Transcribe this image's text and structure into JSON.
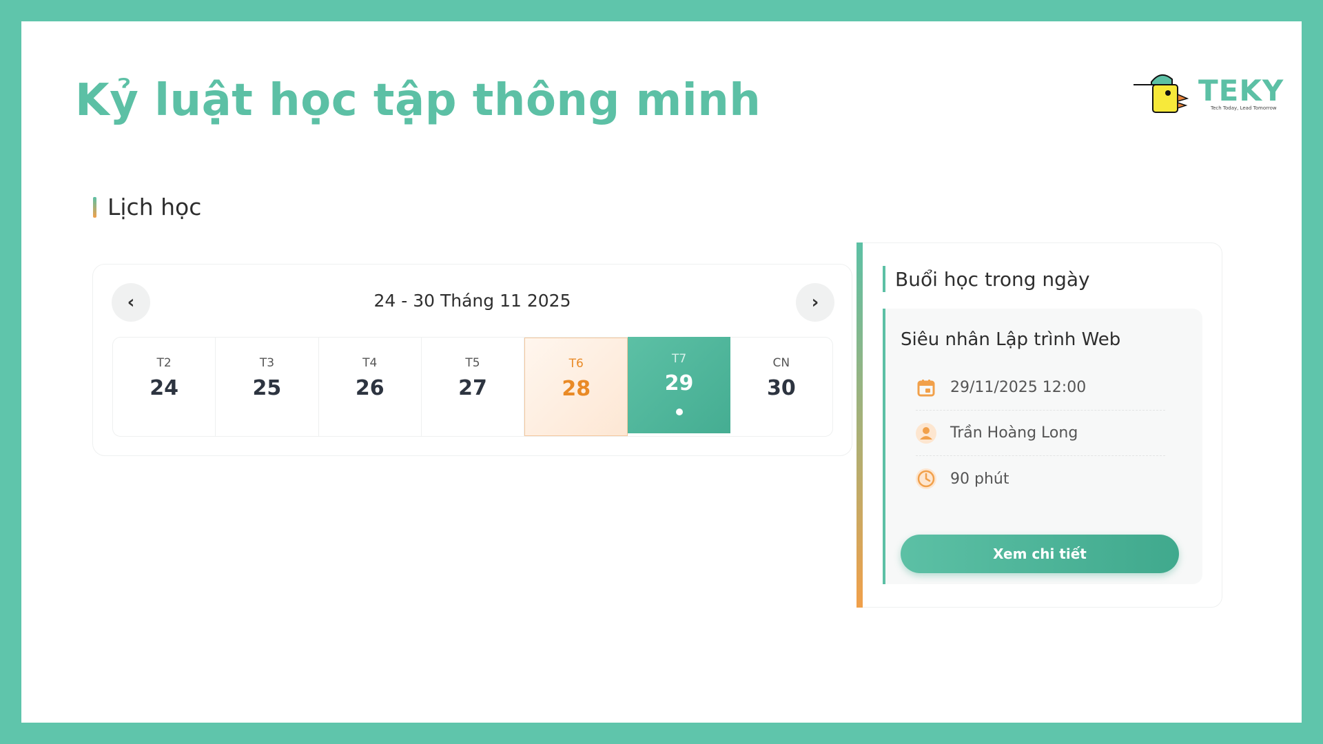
{
  "page": {
    "title": "Kỷ luật học tập thông minh"
  },
  "logo": {
    "text": "TEKY",
    "tagline": "Tech Today, Lead Tomorrow"
  },
  "section": {
    "title": "Lịch học"
  },
  "calendar": {
    "range_label": "24 - 30 Tháng 11 2025",
    "prev_icon": "chevron-left-icon",
    "next_icon": "chevron-right-icon",
    "days": [
      {
        "weekday": "T2",
        "date": "24"
      },
      {
        "weekday": "T3",
        "date": "25"
      },
      {
        "weekday": "T4",
        "date": "26"
      },
      {
        "weekday": "T5",
        "date": "27"
      },
      {
        "weekday": "T6",
        "date": "28",
        "state": "today"
      },
      {
        "weekday": "T7",
        "date": "29",
        "state": "selected",
        "has_event": true
      },
      {
        "weekday": "CN",
        "date": "30"
      }
    ]
  },
  "sessions_panel": {
    "title": "Buổi học trong ngày",
    "session": {
      "name": "Siêu nhân Lập trình Web",
      "datetime": "29/11/2025 12:00",
      "teacher": "Trần Hoàng Long",
      "duration": "90 phút",
      "detail_button": "Xem chi tiết"
    }
  },
  "colors": {
    "primary": "#5cc0a5",
    "accent_orange": "#e98a26",
    "frame": "#5fc5ab"
  }
}
